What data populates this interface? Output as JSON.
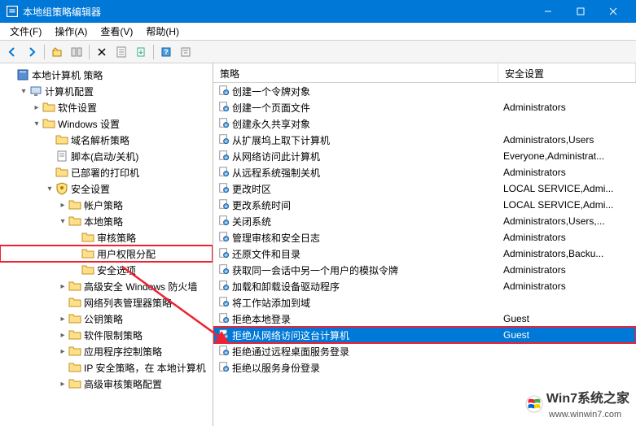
{
  "window": {
    "title": "本地组策略编辑器"
  },
  "menu": {
    "file": "文件(F)",
    "action": "操作(A)",
    "view": "查看(V)",
    "help": "帮助(H)"
  },
  "tree": {
    "root": "本地计算机 策略",
    "computer_config": "计算机配置",
    "software_settings": "软件设置",
    "windows_settings": "Windows 设置",
    "name_res_policy": "域名解析策略",
    "scripts": "脚本(启动/关机)",
    "deployed_printers": "已部署的打印机",
    "security_settings": "安全设置",
    "account_policies": "帐户策略",
    "local_policies": "本地策略",
    "audit_policy": "审核策略",
    "user_rights": "用户权限分配",
    "security_options": "安全选项",
    "windows_firewall": "高级安全 Windows 防火墙",
    "network_list": "网络列表管理器策略",
    "public_key": "公钥策略",
    "software_restriction": "软件限制策略",
    "app_control": "应用程序控制策略",
    "ip_security": "IP 安全策略，在 本地计算机",
    "advanced_audit": "高级审核策略配置"
  },
  "columns": {
    "policy": "策略",
    "setting": "安全设置"
  },
  "policies": [
    {
      "name": "创建一个令牌对象",
      "setting": ""
    },
    {
      "name": "创建一个页面文件",
      "setting": "Administrators"
    },
    {
      "name": "创建永久共享对象",
      "setting": ""
    },
    {
      "name": "从扩展坞上取下计算机",
      "setting": "Administrators,Users"
    },
    {
      "name": "从网络访问此计算机",
      "setting": "Everyone,Administrat..."
    },
    {
      "name": "从远程系统强制关机",
      "setting": "Administrators"
    },
    {
      "name": "更改时区",
      "setting": "LOCAL SERVICE,Admi..."
    },
    {
      "name": "更改系统时间",
      "setting": "LOCAL SERVICE,Admi..."
    },
    {
      "name": "关闭系统",
      "setting": "Administrators,Users,..."
    },
    {
      "name": "管理审核和安全日志",
      "setting": "Administrators"
    },
    {
      "name": "还原文件和目录",
      "setting": "Administrators,Backu..."
    },
    {
      "name": "获取同一会话中另一个用户的模拟令牌",
      "setting": "Administrators"
    },
    {
      "name": "加载和卸载设备驱动程序",
      "setting": "Administrators"
    },
    {
      "name": "将工作站添加到域",
      "setting": ""
    },
    {
      "name": "拒绝本地登录",
      "setting": "Guest"
    },
    {
      "name": "拒绝从网络访问这台计算机",
      "setting": "Guest",
      "selected": true,
      "highlight": true
    },
    {
      "name": "拒绝通过远程桌面服务登录",
      "setting": ""
    },
    {
      "name": "拒绝以服务身份登录",
      "setting": ""
    }
  ],
  "watermark": {
    "brand": "Win7系统之家",
    "sub": "www.winwin7.com"
  }
}
